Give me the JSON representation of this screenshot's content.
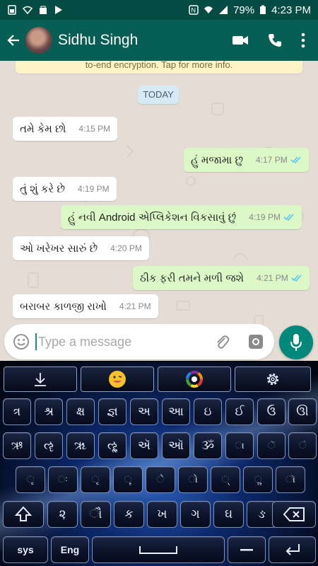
{
  "status_bar": {
    "battery": "79%",
    "time": "4:23 PM",
    "icons": [
      "sim-icon",
      "wifi-icon",
      "bag-icon",
      "play-icon",
      "nfc-icon",
      "wifi-icon",
      "signal-icon",
      "battery-icon"
    ]
  },
  "header": {
    "contact_name": "Sidhu Singh",
    "icons": [
      "back-arrow-icon",
      "video-call-icon",
      "phone-icon",
      "more-vert-icon"
    ]
  },
  "chat": {
    "encryption_note": "to-end encryption. Tap for more info.",
    "date_label": "TODAY",
    "messages": [
      {
        "direction": "in",
        "text": "તમે કેમ છો",
        "time": "4:15 PM"
      },
      {
        "direction": "out",
        "text": "હું મજામા છુ",
        "time": "4:17 PM",
        "status": "read"
      },
      {
        "direction": "in",
        "text": "તું શું કરે છે",
        "time": "4:19 PM"
      },
      {
        "direction": "out",
        "text": "હું નવી Android એપ્લિકેશન વિકસાવું છું",
        "time": "4:19 PM",
        "status": "read"
      },
      {
        "direction": "in",
        "text": "ઓ ખરેખર સારું છે",
        "time": "4:20 PM"
      },
      {
        "direction": "out",
        "text": "ઠીક ફરી તમને મળી જશે",
        "time": "4:21 PM",
        "status": "read"
      },
      {
        "direction": "in",
        "text": "બરાબર કાળજી રાખો",
        "time": "4:21 PM"
      }
    ]
  },
  "compose": {
    "placeholder": "Type a message"
  },
  "keyboard": {
    "toolbar": [
      "collapse-icon",
      "emoji-face-icon",
      "theme-color-wheel-icon",
      "settings-gear-icon"
    ],
    "row1": [
      "ત્ર",
      "શ્ર",
      "ક્ષ",
      "જ્ઞ",
      "અ",
      "આ",
      "ઇ",
      "ઈ",
      "ઉ",
      "ઊ"
    ],
    "row2": [
      "ઋ",
      "ૡ",
      "ૠ",
      "ૡૢ",
      "ઍ",
      "ઑ",
      "ૐ",
      "◌ા",
      "◌ૅ",
      "◌ં"
    ],
    "row3": [
      "◌ૃ",
      "◌ઃ",
      "◌ૃ",
      "◌ૄ",
      "◌ે",
      "◌ો",
      "◌્",
      "◌ૢ",
      "◌ૉ"
    ],
    "row4": [
      "૨઼",
      "ૌ",
      "ક",
      "ખ",
      "ગ",
      "ઘ",
      "ઙ"
    ],
    "bottom": {
      "sym": "sys",
      "lang": "Eng"
    }
  },
  "colors": {
    "header": "#075e54",
    "status_bar": "#054d44",
    "incoming": "#ffffff",
    "outgoing": "#dcf8c6",
    "accent": "#00897b",
    "read_ticks": "#4fc3f7"
  }
}
